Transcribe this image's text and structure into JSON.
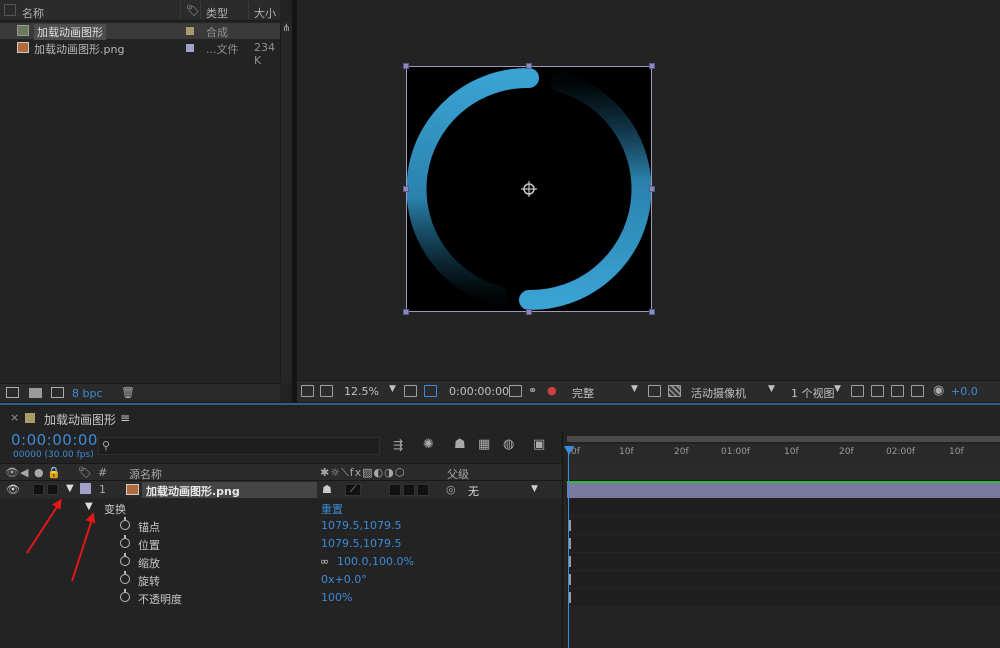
{
  "project": {
    "columns": {
      "name": "名称",
      "type": "类型",
      "size": "大小"
    },
    "items": [
      {
        "name": "加载动画图形",
        "type": "合成",
        "size": ""
      },
      {
        "name": "加载动画图形.png",
        "type": "...文件",
        "size": "234 K"
      }
    ],
    "bpc": "8 bpc"
  },
  "viewer": {
    "zoom": "12.5%",
    "timecode": "0:00:00:00",
    "resolution": "完整",
    "camera": "活动摄像机",
    "views": "1 个视图",
    "exposure": "+0.0"
  },
  "timeline": {
    "tab_title": "加载动画图形",
    "tab_menu": "≡",
    "timecode": "0:00:00:00",
    "fps_line": "00000 (30.00 fps)",
    "columns": {
      "num": "#",
      "source": "源名称",
      "parent": "父级"
    },
    "layer": {
      "index": "1",
      "name": "加载动画图形.png",
      "parent": "无"
    },
    "transform": {
      "label": "变换",
      "reset": "重置"
    },
    "properties": [
      {
        "name": "锚点",
        "value": "1079.5,1079.5"
      },
      {
        "name": "位置",
        "value": "1079.5,1079.5"
      },
      {
        "name": "缩放",
        "value": "100.0,100.0%"
      },
      {
        "name": "旋转",
        "value": "0x+0.0°"
      },
      {
        "name": "不透明度",
        "value": "100%"
      }
    ],
    "ruler": [
      "0f",
      "10f",
      "20f",
      "01:00f",
      "10f",
      "20f",
      "02:00f",
      "10f"
    ]
  },
  "colors": {
    "accent": "#3d8ad6",
    "ring": "#3aa3d4",
    "layer_bar": "#7a7a9e",
    "arrow": "#e01818"
  }
}
